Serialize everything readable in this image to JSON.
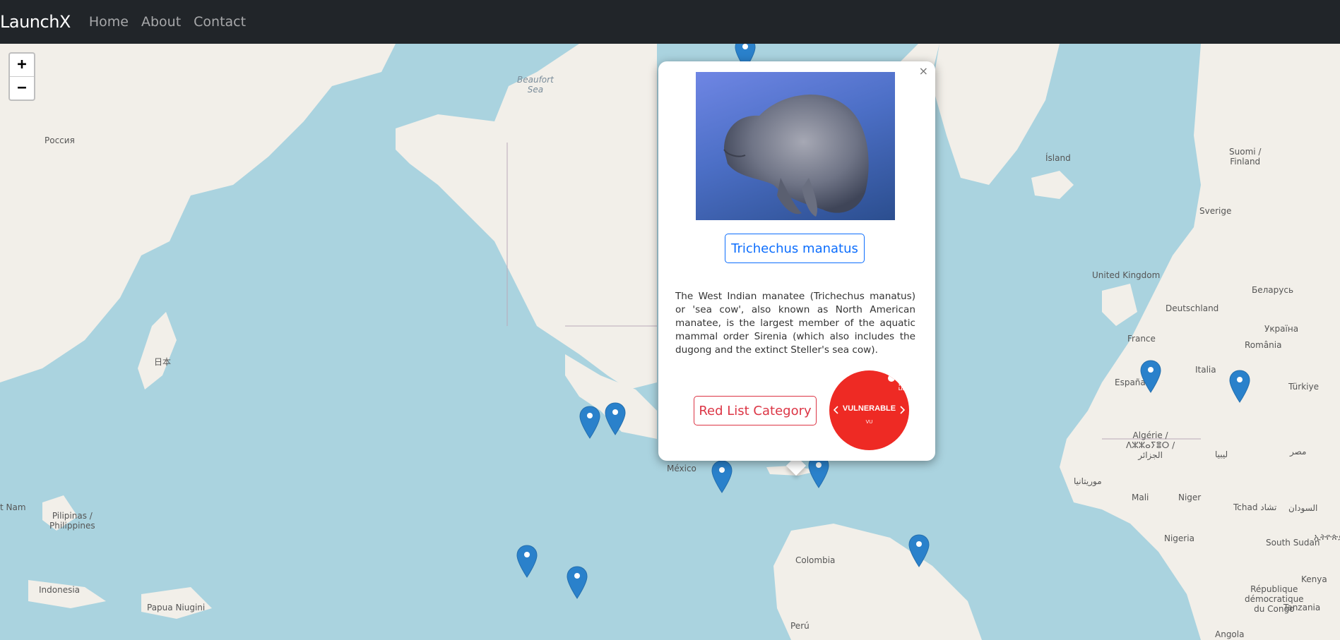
{
  "navbar": {
    "brand": "LaunchX",
    "links": [
      "Home",
      "About",
      "Contact"
    ]
  },
  "map": {
    "zoom_in": "+",
    "zoom_out": "−",
    "places": {
      "rossiya": "Россия",
      "beaufort_1": "Beaufort",
      "beaufort_2": "Sea",
      "iceland": "Ísland",
      "suomi_1": "Suomi /",
      "suomi_2": "Finland",
      "sverige": "Sverige",
      "uk": "United Kingdom",
      "belarus": "Беларусь",
      "deutschland": "Deutschland",
      "ukraina": "Україна",
      "france": "France",
      "romania": "România",
      "italia": "Italia",
      "espana": "España",
      "turkiye": "Türkiye",
      "japan": "日本",
      "mexico": "México",
      "algerie_1": "Algérie /",
      "algerie_2": "ⴷⵣⵣⴰⵢⴻⵔ /",
      "algerie_3": "الجزائر",
      "libya": "ليبيا",
      "egypt": "مصر",
      "mauritania": "موريتانيا",
      "mali": "Mali",
      "niger": "Niger",
      "chad": "Tchad تشاد",
      "sudan": "السودان",
      "nigeria": "Nigeria",
      "south_sudan": "South Sudan",
      "ethiopia": "ኢትዮጵያ",
      "kenya": "Kenya",
      "rdc_1": "République",
      "rdc_2": "démocratique",
      "rdc_3": "du Congo",
      "tanzania": "Tanzania",
      "angola": "Angola",
      "colombia": "Colombia",
      "peru": "Perú",
      "vietnam": "t Nam",
      "philippines_1": "Pilipinas /",
      "philippines_2": "Philippines",
      "indonesia": "Indonesia",
      "png": "Papua Niugini"
    }
  },
  "popup": {
    "close": "×",
    "species_name": "Trichechus manatus",
    "description": "The West Indian manatee (Trichechus manatus) or 'sea cow', also known as North American manatee, is the largest member of the aquatic mammal order Sirenia (which also includes the dugong and the extinct Steller's sea cow).",
    "category_button": "Red List Category",
    "badge": {
      "label": "VULNERABLE",
      "code": "VU",
      "logo_text_1": "RED",
      "logo_text_2": "LIST",
      "color": "#ee2a24"
    }
  },
  "colors": {
    "water": "#aad3df",
    "land": "#f2efe9",
    "navbar": "#212529",
    "marker": "#2a81cb",
    "primary": "#0d6efd",
    "danger": "#dc3545"
  },
  "icons": [
    "map-marker-icon",
    "chevron-left-icon",
    "chevron-right-icon",
    "red-list-logo-icon",
    "close-icon"
  ]
}
